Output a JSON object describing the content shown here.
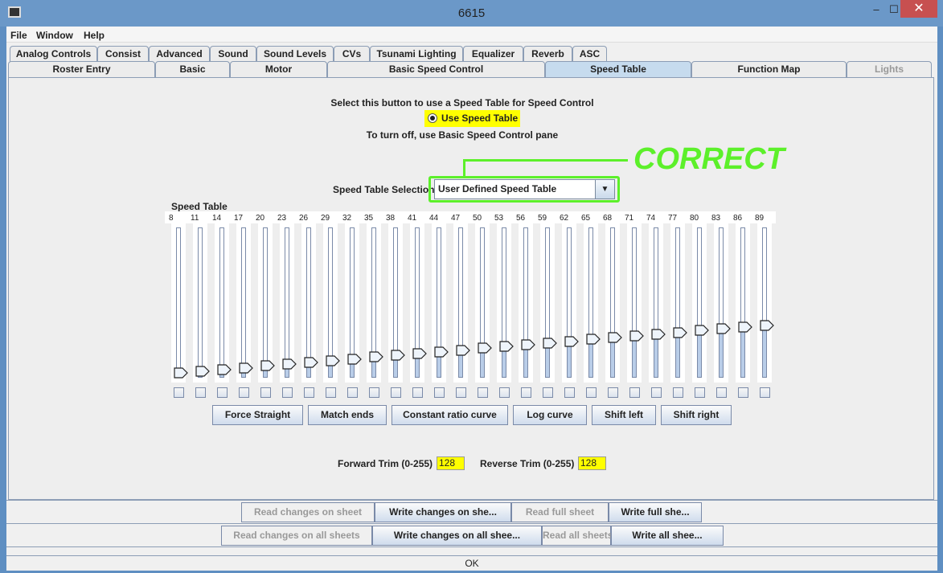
{
  "window": {
    "title": "6615",
    "minimize": "–",
    "maximize": "☐",
    "close": "✕"
  },
  "menu": [
    "File",
    "Window",
    "Help"
  ],
  "tabs_row1": [
    "Analog Controls",
    "Consist",
    "Advanced",
    "Sound",
    "Sound Levels",
    "CVs",
    "Tsunami Lighting",
    "Equalizer",
    "Reverb",
    "ASC"
  ],
  "tabs_row2": [
    "Roster Entry",
    "Basic",
    "Motor",
    "Basic Speed Control",
    "Speed Table",
    "Function Map",
    "Lights"
  ],
  "selected_tab": "Speed Table",
  "speed_table": {
    "instruction": "Select this button to use a Speed Table for Speed Control",
    "radio_label": "Use Speed Table",
    "radio_selected": true,
    "turn_off_note": "To turn off, use Basic Speed Control pane",
    "selection_label": "Speed Table Selection",
    "selection_value": "User Defined Speed Table",
    "annotation": "CORRECT",
    "table_label": "Speed Table",
    "slider_max": 255,
    "values": [
      8,
      11,
      14,
      17,
      20,
      23,
      26,
      29,
      32,
      35,
      38,
      41,
      44,
      47,
      50,
      53,
      56,
      59,
      62,
      65,
      68,
      71,
      74,
      77,
      80,
      83,
      86,
      89
    ],
    "buttons": [
      "Force Straight",
      "Match ends",
      "Constant ratio curve",
      "Log curve",
      "Shift left",
      "Shift right"
    ],
    "forward_trim_label": "Forward Trim (0-255)",
    "forward_trim": "128",
    "reverse_trim_label": "Reverse Trim (0-255)",
    "reverse_trim": "128"
  },
  "sheet_buttons": [
    "Read changes on sheet",
    "Write changes on she...",
    "Read full sheet",
    "Write full she..."
  ],
  "all_buttons": [
    "Read changes on all sheets",
    "Write changes on all shee...",
    "Read all sheets",
    "Write all shee..."
  ],
  "ok": "OK",
  "colors": {
    "highlight": "#ffff00",
    "annotation": "#5cf02a",
    "selected_tab": "#c6dbee"
  }
}
